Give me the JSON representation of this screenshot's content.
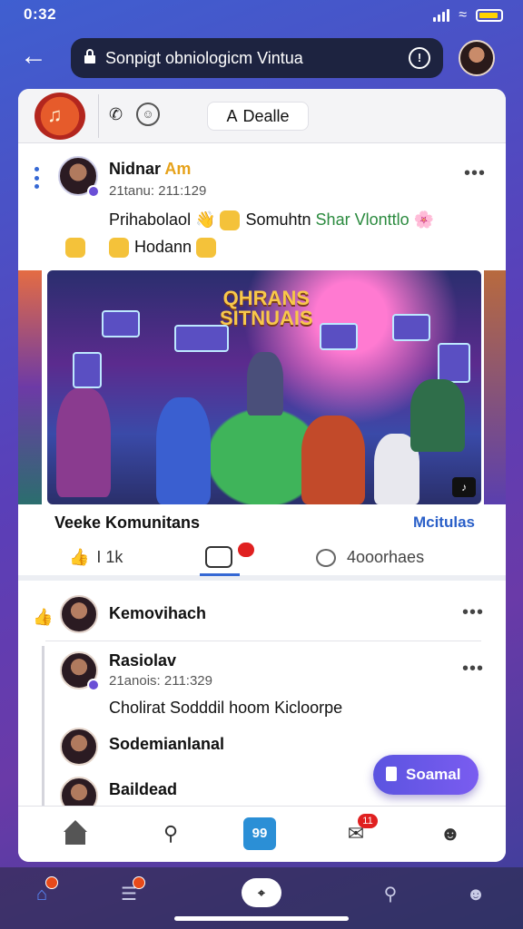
{
  "status_bar": {
    "time": "0:32"
  },
  "browser": {
    "url": "Sonpigt obniologicm Vintua"
  },
  "group": {
    "join_label": "Dealle"
  },
  "post": {
    "author": "Nidnar",
    "author_suffix": "Am",
    "time": "21tanu: 211:129",
    "text_a": "Prihabolaol",
    "text_b": "Somuhtn",
    "text_c": "Shar Vlonttlo",
    "text_line2": "Hodann",
    "image_title_1": "QHRANS",
    "image_title_2": "SITNUAIS",
    "caption": "Veeke Komunitans",
    "caption_right": "Mcitulas",
    "like_count": "I 1k",
    "share_label": "4ooorhaes"
  },
  "comments": {
    "header_name": "Kemovihach",
    "replies": [
      {
        "name": "Rasiolav",
        "time": "21anois: 211:329",
        "text": "Cholirat   Sodddil hoom   Kicloorpe"
      },
      {
        "name": "Sodemianlanal"
      },
      {
        "name": "Baildead"
      }
    ]
  },
  "fab": {
    "label": "Soamal"
  },
  "tabbar": {
    "center_label": "99",
    "message_badge": "11"
  },
  "colors": {
    "accent": "#3568d4",
    "fab": "#5b54e0",
    "badge": "#e02020"
  }
}
